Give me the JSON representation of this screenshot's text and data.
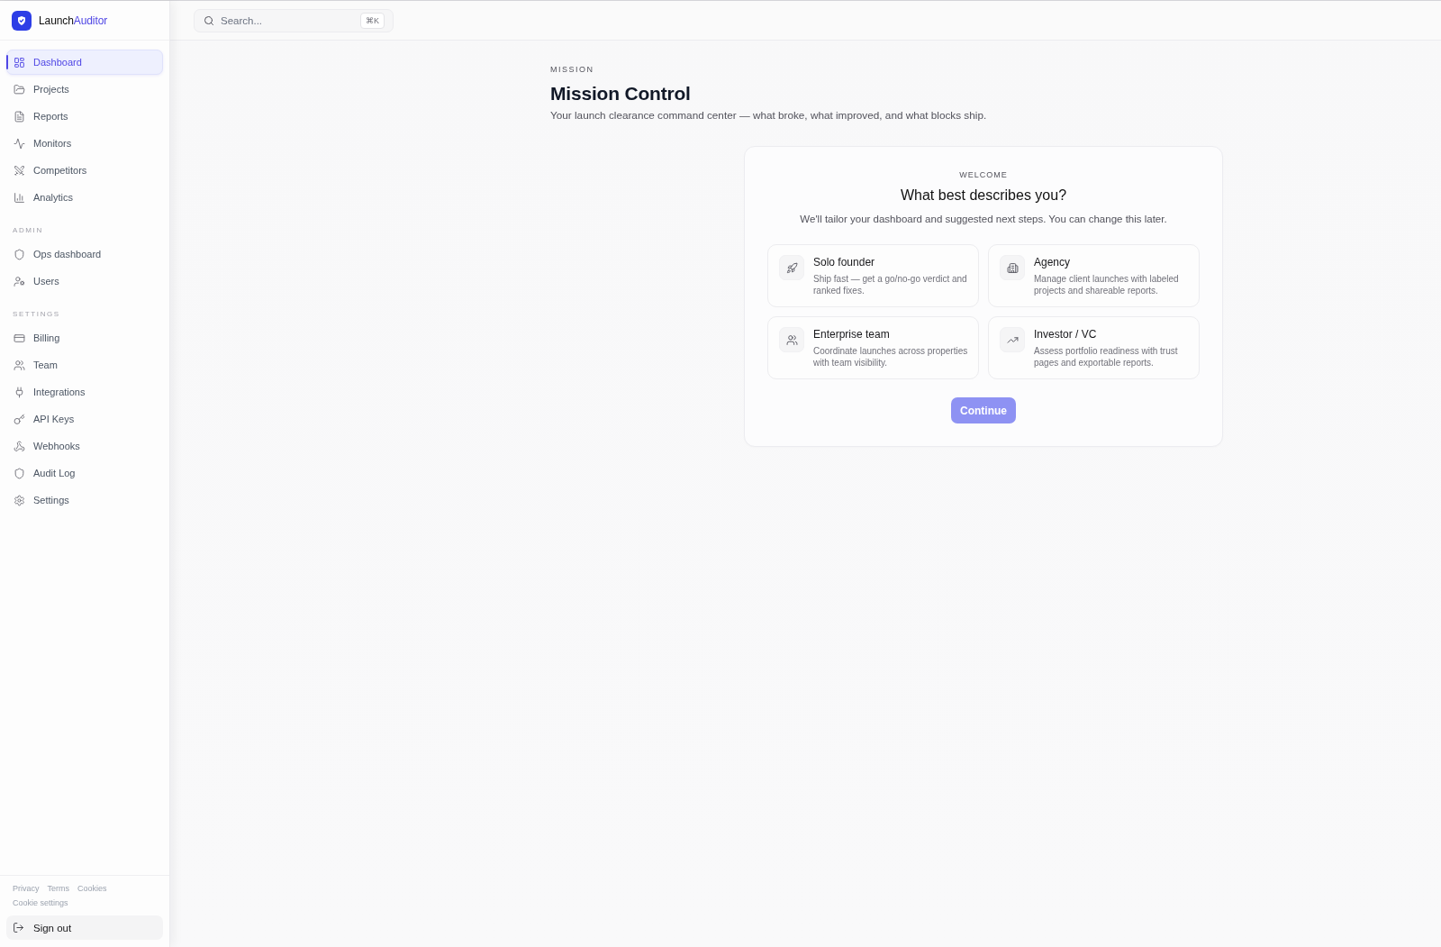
{
  "sidebar": {
    "brand": {
      "name": "Launch",
      "accent": "Auditor"
    },
    "nav": [
      {
        "label": "Dashboard",
        "selected": true
      },
      {
        "label": "Projects",
        "selected": false
      },
      {
        "label": "Reports",
        "selected": false
      },
      {
        "label": "Monitors",
        "selected": false
      },
      {
        "label": "Competitors",
        "selected": false
      },
      {
        "label": "Analytics",
        "selected": false
      }
    ],
    "sections": [
      {
        "title": "ADMIN",
        "items": [
          {
            "label": "Ops dashboard",
            "selected": false
          },
          {
            "label": "Users",
            "selected": false
          }
        ]
      },
      {
        "title": "SETTINGS",
        "items": [
          {
            "label": "Billing",
            "selected": false
          },
          {
            "label": "Team",
            "selected": false
          },
          {
            "label": "Integrations",
            "selected": false
          },
          {
            "label": "API Keys",
            "selected": false
          },
          {
            "label": "Webhooks",
            "selected": false
          },
          {
            "label": "Audit Log",
            "selected": false
          },
          {
            "label": "Settings",
            "selected": false
          }
        ]
      }
    ],
    "footer_links": [
      "Privacy",
      "Terms",
      "Cookies",
      "Cookie settings"
    ],
    "sign_out": "Sign out"
  },
  "header": {
    "search": {
      "placeholder": "Search...",
      "shortcut": "⌘K"
    }
  },
  "page": {
    "eyebrow": "MISSION",
    "title": "Mission Control",
    "subtitle": "Your launch clearance command center — what broke, what improved, and what blocks ship."
  },
  "onboarding": {
    "eyebrow": "WELCOME",
    "title": "What best describes you?",
    "subtitle": "We'll tailor your dashboard and suggested next steps. You can change this later.",
    "options": [
      {
        "title": "Solo founder",
        "description": "Ship fast — get a go/no-go verdict and ranked fixes.",
        "selected": false
      },
      {
        "title": "Agency",
        "description": "Manage client launches with labeled projects and shareable reports.",
        "selected": false
      },
      {
        "title": "Enterprise team",
        "description": "Coordinate launches across properties with team visibility.",
        "selected": false
      },
      {
        "title": "Investor / VC",
        "description": "Assess portfolio readiness with trust pages and exportable reports.",
        "selected": false
      }
    ],
    "continue_button": {
      "label": "Continue",
      "disabled": true
    }
  }
}
